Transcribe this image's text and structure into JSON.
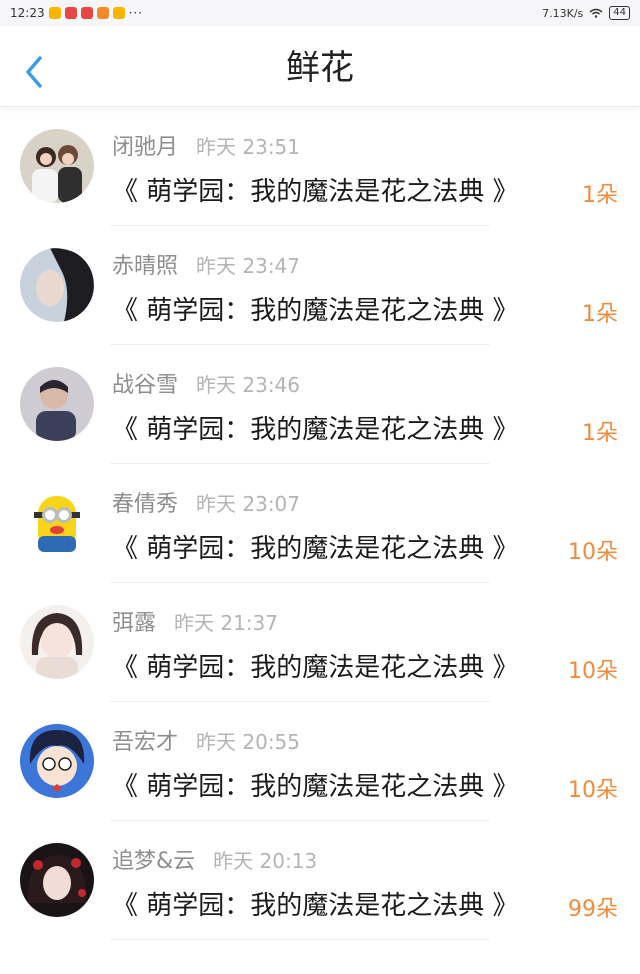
{
  "status_bar": {
    "time": "12:23",
    "dots": "···",
    "speed": "7.13K/s",
    "battery": "44"
  },
  "header": {
    "title": "鲜花"
  },
  "items": [
    {
      "user": "闭驰月",
      "time": "昨天 23:51",
      "book": "《 萌学园：我的魔法是花之法典 》",
      "count": "1朵"
    },
    {
      "user": "赤晴照",
      "time": "昨天 23:47",
      "book": "《 萌学园：我的魔法是花之法典 》",
      "count": "1朵"
    },
    {
      "user": "战谷雪",
      "time": "昨天 23:46",
      "book": "《 萌学园：我的魔法是花之法典 》",
      "count": "1朵"
    },
    {
      "user": "春倩秀",
      "time": "昨天 23:07",
      "book": "《 萌学园：我的魔法是花之法典 》",
      "count": "10朵"
    },
    {
      "user": "弭露",
      "time": "昨天 21:37",
      "book": "《 萌学园：我的魔法是花之法典 》",
      "count": "10朵"
    },
    {
      "user": "吾宏才",
      "time": "昨天 20:55",
      "book": "《 萌学园：我的魔法是花之法典 》",
      "count": "10朵"
    },
    {
      "user": "追梦&云",
      "time": "昨天 20:13",
      "book": "《 萌学园：我的魔法是花之法典 》",
      "count": "99朵"
    }
  ],
  "colors": {
    "accent_blue": "#3a9be6",
    "count_orange": "#f08b3c"
  }
}
